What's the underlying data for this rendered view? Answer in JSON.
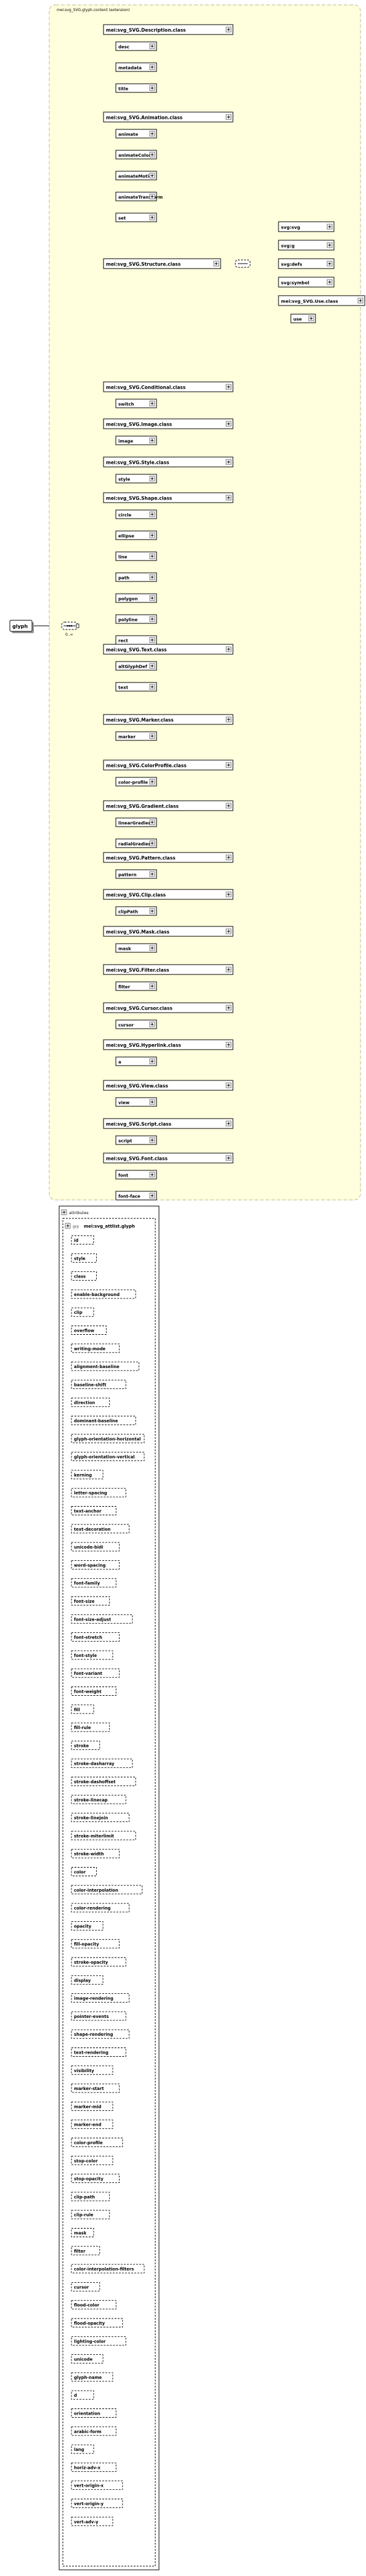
{
  "root": {
    "label": "glyph",
    "cardinality": "0..∞"
  },
  "ext_group": {
    "title": "mei:svg_SVG.glyph.content (extension)"
  },
  "classes": [
    {
      "label": "mei:svg_SVG.Description.class",
      "members": [
        "desc",
        "metadata",
        "title"
      ]
    },
    {
      "label": "mei:svg_SVG.Animation.class",
      "members": [
        "animate",
        "animateColor",
        "animateMotion",
        "animateTransform",
        "set"
      ]
    },
    {
      "label": "mei:svg_SVG.Structure.class",
      "members": [],
      "sub": [
        "svg:svg",
        "svg:g",
        "svg:defs",
        "svg:symbol",
        "mei:svg_SVG.Use.class"
      ],
      "use": "use"
    },
    {
      "label": "mei:svg_SVG.Conditional.class",
      "members": [
        "switch"
      ]
    },
    {
      "label": "mei:svg_SVG.Image.class",
      "members": [
        "image"
      ]
    },
    {
      "label": "mei:svg_SVG.Style.class",
      "members": [
        "style"
      ]
    },
    {
      "label": "mei:svg_SVG.Shape.class",
      "members": [
        "circle",
        "ellipse",
        "line",
        "path",
        "polygon",
        "polyline",
        "rect"
      ]
    },
    {
      "label": "mei:svg_SVG.Text.class",
      "members": [
        "altGlyphDef",
        "text"
      ]
    },
    {
      "label": "mei:svg_SVG.Marker.class",
      "members": [
        "marker"
      ]
    },
    {
      "label": "mei:svg_SVG.ColorProfile.class",
      "members": [
        "color-profile"
      ]
    },
    {
      "label": "mei:svg_SVG.Gradient.class",
      "members": [
        "linearGradient",
        "radialGradient"
      ]
    },
    {
      "label": "mei:svg_SVG.Pattern.class",
      "members": [
        "pattern"
      ]
    },
    {
      "label": "mei:svg_SVG.Clip.class",
      "members": [
        "clipPath"
      ]
    },
    {
      "label": "mei:svg_SVG.Mask.class",
      "members": [
        "mask"
      ]
    },
    {
      "label": "mei:svg_SVG.Filter.class",
      "members": [
        "filter"
      ]
    },
    {
      "label": "mei:svg_SVG.Cursor.class",
      "members": [
        "cursor"
      ]
    },
    {
      "label": "mei:svg_SVG.Hyperlink.class",
      "members": [
        "a"
      ]
    },
    {
      "label": "mei:svg_SVG.View.class",
      "members": [
        "view"
      ]
    },
    {
      "label": "mei:svg_SVG.Script.class",
      "members": [
        "script"
      ]
    },
    {
      "label": "mei:svg_SVG.Font.class",
      "members": [
        "font",
        "font-face"
      ]
    }
  ],
  "attributes": {
    "title": "attributes",
    "group": "mei:svg_attlist.glyph",
    "items": [
      "id",
      "style",
      "class",
      "enable-background",
      "clip",
      "overflow",
      "writing-mode",
      "alignment-baseline",
      "baseline-shift",
      "direction",
      "dominant-baseline",
      "glyph-orientation-horizontal",
      "glyph-orientation-vertical",
      "kerning",
      "letter-spacing",
      "text-anchor",
      "text-decoration",
      "unicode-bidi",
      "word-spacing",
      "font-family",
      "font-size",
      "font-size-adjust",
      "font-stretch",
      "font-style",
      "font-variant",
      "font-weight",
      "fill",
      "fill-rule",
      "stroke",
      "stroke-dasharray",
      "stroke-dashoffset",
      "stroke-linecap",
      "stroke-linejoin",
      "stroke-miterlimit",
      "stroke-width",
      "color",
      "color-interpolation",
      "color-rendering",
      "opacity",
      "fill-opacity",
      "stroke-opacity",
      "display",
      "image-rendering",
      "pointer-events",
      "shape-rendering",
      "text-rendering",
      "visibility",
      "marker-start",
      "marker-mid",
      "marker-end",
      "color-profile",
      "stop-color",
      "stop-opacity",
      "clip-path",
      "clip-rule",
      "mask",
      "filter",
      "color-interpolation-filters",
      "cursor",
      "flood-color",
      "flood-opacity",
      "lighting-color",
      "unicode",
      "glyph-name",
      "d",
      "orientation",
      "arabic-form",
      "lang",
      "horiz-adv-x",
      "vert-origin-x",
      "vert-origin-y",
      "vert-adv-y"
    ]
  },
  "colors": {
    "group_fill": "#ffffdd",
    "group_stroke": "#c8c8a0",
    "box_fill": "#ffffff",
    "line": "#000000"
  }
}
